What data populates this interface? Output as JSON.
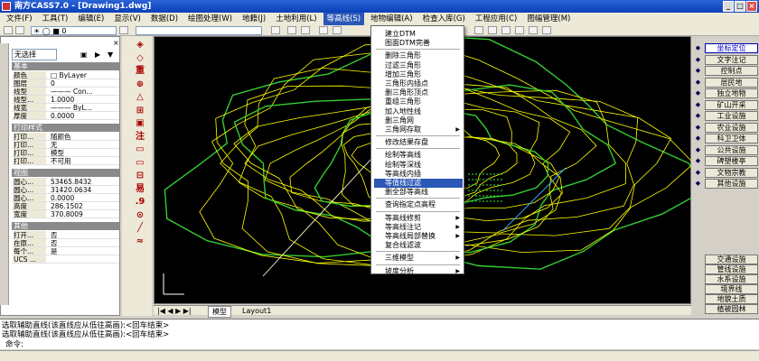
{
  "window": {
    "title": "南方CASS7.0 - [Drawing1.dwg]"
  },
  "menubar": [
    "文件(F)",
    "工具(T)",
    "编辑(E)",
    "显示(V)",
    "数据(D)",
    "绘图处理(W)",
    "地籍(J)",
    "土地利用(L)",
    "等高线(S)",
    "地物编辑(A)",
    "检查入库(G)",
    "工程应用(C)",
    "图幅管理(M)"
  ],
  "toolbar": {
    "layer_value": "0"
  },
  "properties": {
    "selection": "无选择",
    "basic_header": "基本",
    "basic": [
      [
        "颜色",
        "□ ByLayer"
      ],
      [
        "图层",
        "0"
      ],
      [
        "线型",
        "——— Con..."
      ],
      [
        "线型...",
        "1.0000"
      ],
      [
        "线宽",
        "——— ByL..."
      ],
      [
        "厚度",
        "0.0000"
      ]
    ],
    "print_header": "打印样式",
    "print": [
      [
        "打印...",
        "随颜色"
      ],
      [
        "打印...",
        "无"
      ],
      [
        "打印...",
        "模型"
      ],
      [
        "打印...",
        "不可用"
      ]
    ],
    "view_header": "视图",
    "view": [
      [
        "圆心...",
        "53465.8432"
      ],
      [
        "圆心...",
        "31420.0634"
      ],
      [
        "圆心...",
        "0.0000"
      ],
      [
        "高度",
        "286.1502"
      ],
      [
        "宽度",
        "370.8009"
      ]
    ],
    "misc_header": "其他",
    "misc": [
      [
        "打开...",
        "否"
      ],
      [
        "在原...",
        "否"
      ],
      [
        "每个...",
        "是"
      ],
      [
        "UCS ...",
        ""
      ]
    ]
  },
  "dropdown": {
    "items": [
      "建立DTM",
      "图面DTM完善",
      "删除三角形",
      "过滤三角形",
      "增加三角形",
      "三角形内插点",
      "删三角形顶点",
      "重组三角形",
      "加入地性线",
      "删三角网",
      "三角网存取",
      "修改结果存盘",
      "绘制等高线",
      "绘制等深线",
      "等高线内插",
      "等值线过滤",
      "删全部等高线",
      "查询指定点高程",
      "等高线修剪",
      "等高线注记",
      "等高线局部替换",
      "复合线滤波",
      "三维模型",
      "坡度分析"
    ],
    "submenu_items": [
      "三角网存取",
      "等高线修剪",
      "等高线注记",
      "等高线局部替换",
      "三维模型",
      "坡度分析"
    ],
    "highlighted": "等值线过滤"
  },
  "right_panel": {
    "buttons_top": [
      "坐标定位",
      "文字注记",
      "控制点",
      "居民地",
      "独立地物",
      "矿山开采",
      "工业设施",
      "农业设施",
      "科卫卫体",
      "公共设施",
      "碑塑楼亭",
      "文物宗教",
      "其他设施"
    ],
    "buttons_bottom": [
      "交通设施",
      "管线设施",
      "水系设施",
      "境界线",
      "地貌土质",
      "植被园林"
    ]
  },
  "tabs": {
    "model": "模型",
    "layout": "Layout1"
  },
  "command": {
    "lines": [
      "选取辅助直线(该直线应从低往高画):<回车结束>",
      "选取辅助直线(该直线应从低往高画):<回车结束>"
    ],
    "prompt": "命令:"
  },
  "colors": {
    "canvas_bg": "#000000",
    "contour_yellow": "#ffff00",
    "contour_green": "#33cc33",
    "highlight": "#2b57b7"
  }
}
